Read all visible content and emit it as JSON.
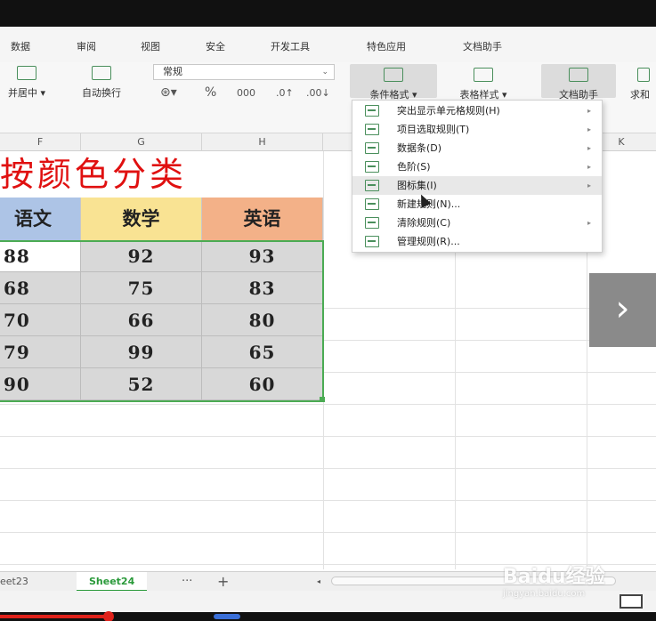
{
  "ribbon_tabs": [
    "数据",
    "审阅",
    "视图",
    "安全",
    "开发工具",
    "特色应用",
    "文档助手"
  ],
  "ribbon": {
    "merge_center": "并居中",
    "wrap_text": "自动换行",
    "number_format": "常规",
    "percent": "%",
    "thousands": "000",
    "conditional_format": "条件格式",
    "table_style": "表格样式",
    "doc_helper": "文档助手",
    "sum": "求和"
  },
  "columns": [
    "F",
    "G",
    "H",
    "K"
  ],
  "sheet_title": "按颜色分类",
  "table": {
    "headers": [
      "语文",
      "数学",
      "英语"
    ],
    "rows": [
      [
        "88",
        "92",
        "93"
      ],
      [
        "68",
        "75",
        "83"
      ],
      [
        "70",
        "66",
        "80"
      ],
      [
        "79",
        "99",
        "65"
      ],
      [
        "90",
        "52",
        "60"
      ]
    ]
  },
  "cond_menu": [
    {
      "label": "突出显示单元格规则(H)",
      "sub": true
    },
    {
      "label": "项目选取规则(T)",
      "sub": true
    },
    {
      "label": "数据条(D)",
      "sub": true
    },
    {
      "label": "色阶(S)",
      "sub": true
    },
    {
      "label": "图标集(I)",
      "sub": true
    },
    {
      "label": "新建规则(N)...",
      "sub": false
    },
    {
      "label": "清除规则(C)",
      "sub": true
    },
    {
      "label": "管理规则(R)...",
      "sub": false
    }
  ],
  "sheets": [
    "eet23",
    "Sheet24"
  ],
  "sheet_more": "···",
  "sheet_add": "+",
  "watermark": {
    "brand": "Baidu经验",
    "url": "jingyan.baidu.com"
  },
  "colors": {
    "title": "#e01010",
    "yuwen_header": "#adc4e6",
    "shuxue_header": "#f9e393",
    "yingyu_header": "#f3b188",
    "selection": "#4bab53",
    "data_fill": "#d8d8d8"
  }
}
